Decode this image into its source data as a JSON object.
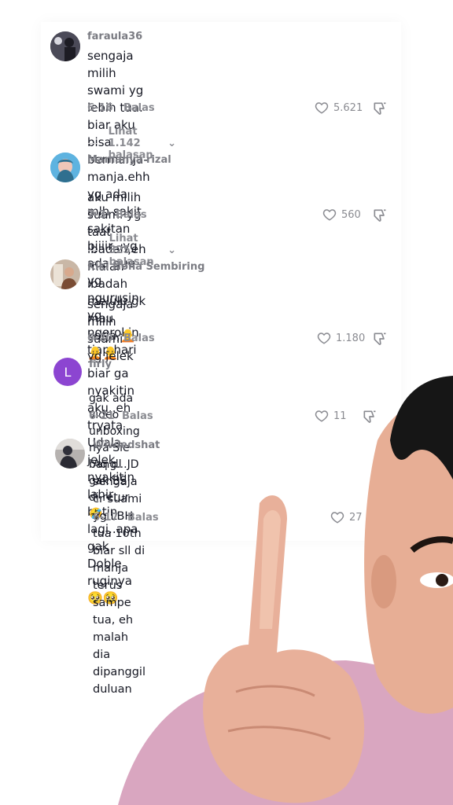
{
  "comments": [
    {
      "username": "faraula36",
      "text": "sengaja milih swami yg lebih tua. biar aku bisa\nbermanja-manja.ehh yg ada mlh sakit sakitan\nbjiiir...yg ada gue yg ngurusin yg ngerokin tiap hari",
      "date": "6-16",
      "reply_label": "Balas",
      "likes": "5.621",
      "view_replies": "Lihat 1.142 balasan"
    },
    {
      "username": "Mamanya rizal",
      "text": "aku milih suami yg taat ibadah,eh malah ibadah\nmelulu gk mau kerja,",
      "date": "7-3",
      "reply_label": "Balas",
      "likes": "560",
      "view_replies": "Lihat 325 balasan"
    },
    {
      "username": "Kiki Nona Sembiring",
      "text": "sengaja milih suami yg jelek biar ga nyakitin\naku..eh tryata Udala jelek nyakitin lahir batin\nlagi..apa gak Doble ruginya",
      "date": "6-20",
      "reply_label": "Balas",
      "likes": "1.180"
    },
    {
      "username": "firly",
      "avatar_letter": "L",
      "text": "gak ada video unboxing nya Sie bang...JD gak BS\ndi retur",
      "date": "6-21",
      "reply_label": "Balas",
      "likes": "11"
    },
    {
      "username": "Wiwiedshat",
      "text": "Aq dl sengaja cr suami yg LBH tua 10th biar sll di\nmanja terus sampe tua, eh malah dia dipanggil\nduluan",
      "date": "6-17",
      "reply_label": "Balas",
      "likes": "27"
    }
  ],
  "colors": {
    "text": "#161823",
    "muted": "#8a8b91",
    "firly_avatar": "#8c45d1",
    "shirt": "#d6a4be",
    "skin": "#e8b09a"
  }
}
